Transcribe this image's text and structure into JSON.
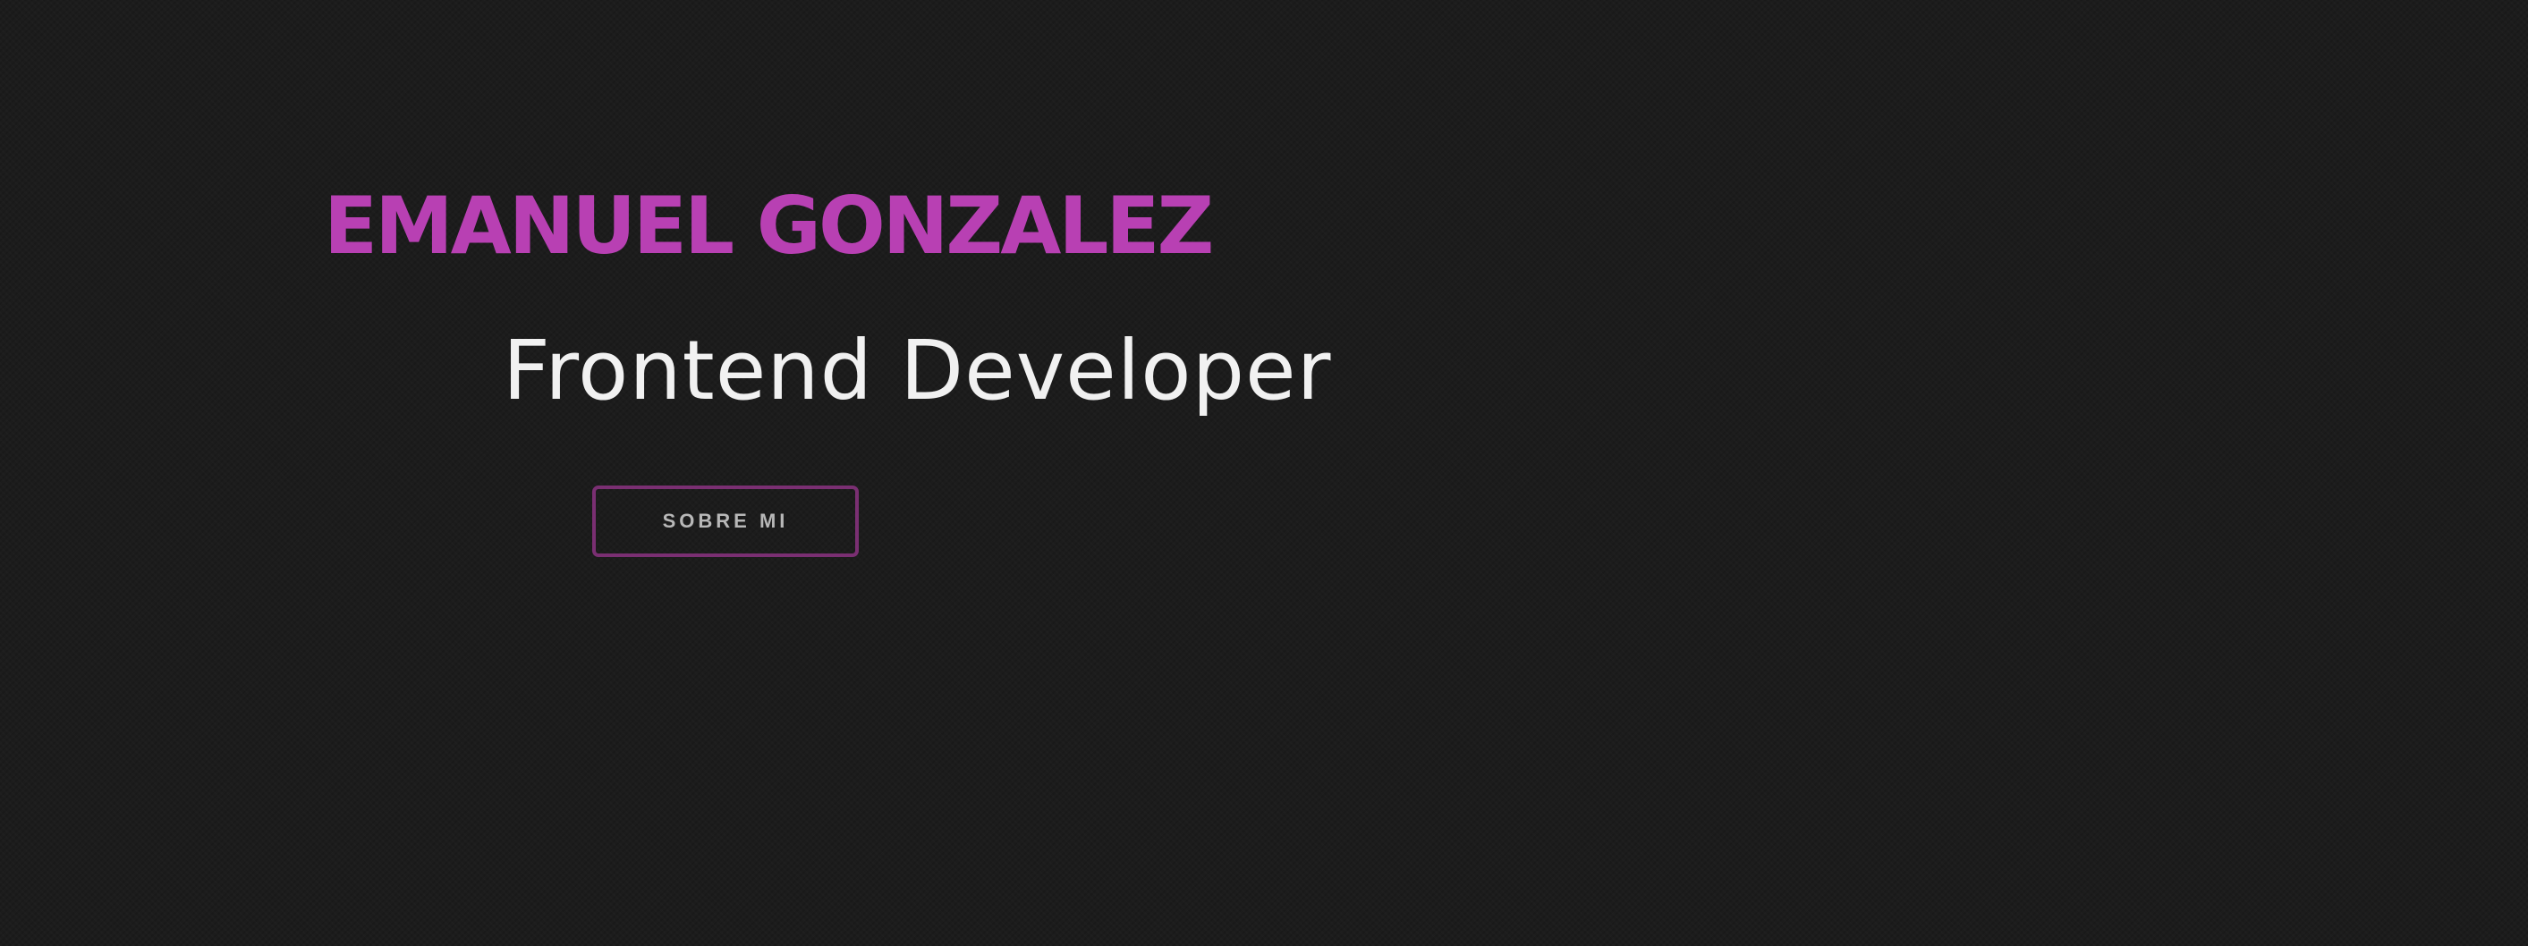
{
  "hero": {
    "name": "EMANUEL GONZALEZ",
    "role": "Frontend Developer",
    "cta_label": "SOBRE MI"
  },
  "colors": {
    "background": "#1c1c1c",
    "name": "#b840b3",
    "role": "#f1f1f1",
    "cta_border": "#7a2f72",
    "cta_text": "#b8b8b8"
  }
}
